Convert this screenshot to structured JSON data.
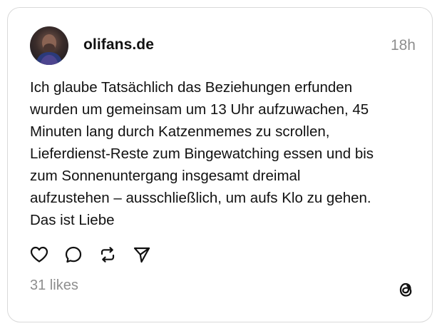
{
  "post": {
    "username": "olifans.de",
    "time": "18h",
    "text": "Ich glaube Tatsächlich das Beziehungen erfunden\nwurden um gemeinsam um 13 Uhr aufzuwachen, 45\nMinuten lang durch Katzenmemes zu scrollen,\nLieferdienst-Reste zum Bingewatching essen und bis\nzum Sonnenuntergang insgesamt dreimal\naufzustehen – ausschließlich, um aufs Klo zu gehen.\nDas ist Liebe",
    "likes": "31 likes"
  },
  "icons": {
    "like": "heart-icon",
    "reply": "comment-icon",
    "repost": "repost-icon",
    "share": "send-icon",
    "brand": "threads-logo-icon"
  },
  "colors": {
    "text": "#111111",
    "muted": "#8e8e8e",
    "border": "#d9d9d9",
    "background": "#ffffff"
  }
}
